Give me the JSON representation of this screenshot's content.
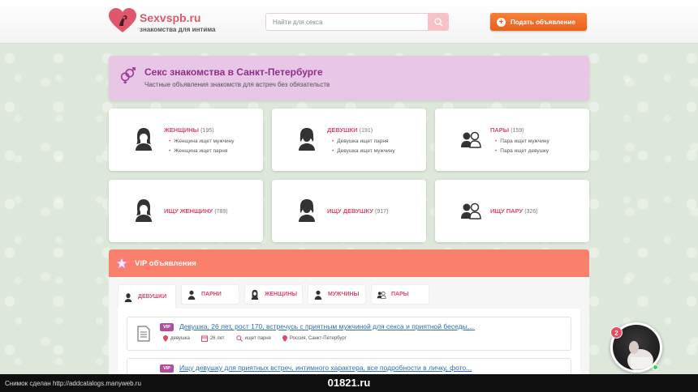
{
  "header": {
    "logo_name": "Sexvspb.ru",
    "logo_sub": "знакомства для интима",
    "search_placeholder": "Найти для секса",
    "add_button": "Подать объявление"
  },
  "hero": {
    "title": "Секс знакомства в Санкт-Петербурге",
    "subtitle": "Частные объявления знакомств для встреч без обязательств"
  },
  "categories": [
    {
      "title": "ЖЕНЩИНЫ",
      "count": "(195)",
      "items": [
        "Женщина ищет мужчину",
        "Женщина ищет парня"
      ],
      "icon": "woman-icon"
    },
    {
      "title": "ДЕВУШКИ",
      "count": "(191)",
      "items": [
        "Девушка ищет парня",
        "Девушка ищет мужчину"
      ],
      "icon": "girl-icon"
    },
    {
      "title": "ПАРЫ",
      "count": "(159)",
      "items": [
        "Пара ищет мужчину",
        "Пара ищет девушку"
      ],
      "icon": "couple-icon"
    }
  ],
  "seek": [
    {
      "title": "ИЩУ ЖЕНЩИНУ",
      "count": "(789)",
      "icon": "woman-icon"
    },
    {
      "title": "ИЩУ ДЕВУШКУ",
      "count": "(917)",
      "icon": "girl-icon"
    },
    {
      "title": "ИЩУ ПАРУ",
      "count": "(326)",
      "icon": "couple-icon"
    }
  ],
  "vip": {
    "title": "VIP объявления",
    "tabs": [
      "ДЕВУШКИ",
      "ПАРНИ",
      "ЖЕНЩИНЫ",
      "МУЖЧИНЫ",
      "ПАРЫ"
    ],
    "ads": [
      {
        "badge": "VIP",
        "title": "Девушка, 26 лет, рост 170, встречусь с приятным мужчиной для секса и приятной беседы,...",
        "meta": [
          "девушка",
          "26 лет",
          "ищет парня",
          "Россия, Санкт-Петербург"
        ]
      },
      {
        "badge": "VIP",
        "title": "Ищу девушку для приятных встреч, интимного характера, все подробности в личку, фото...",
        "meta": []
      }
    ]
  },
  "chat": {
    "badge": "2"
  },
  "footer": {
    "left": "Снимок сделан http://addcatalogs.manyweb.ru",
    "center": "01821.ru"
  },
  "colors": {
    "accent": "#e0496a",
    "orange": "#e9611c",
    "vip": "#fb7f6d",
    "hero": "#e8c6e5",
    "purple": "#8e2f8a"
  }
}
